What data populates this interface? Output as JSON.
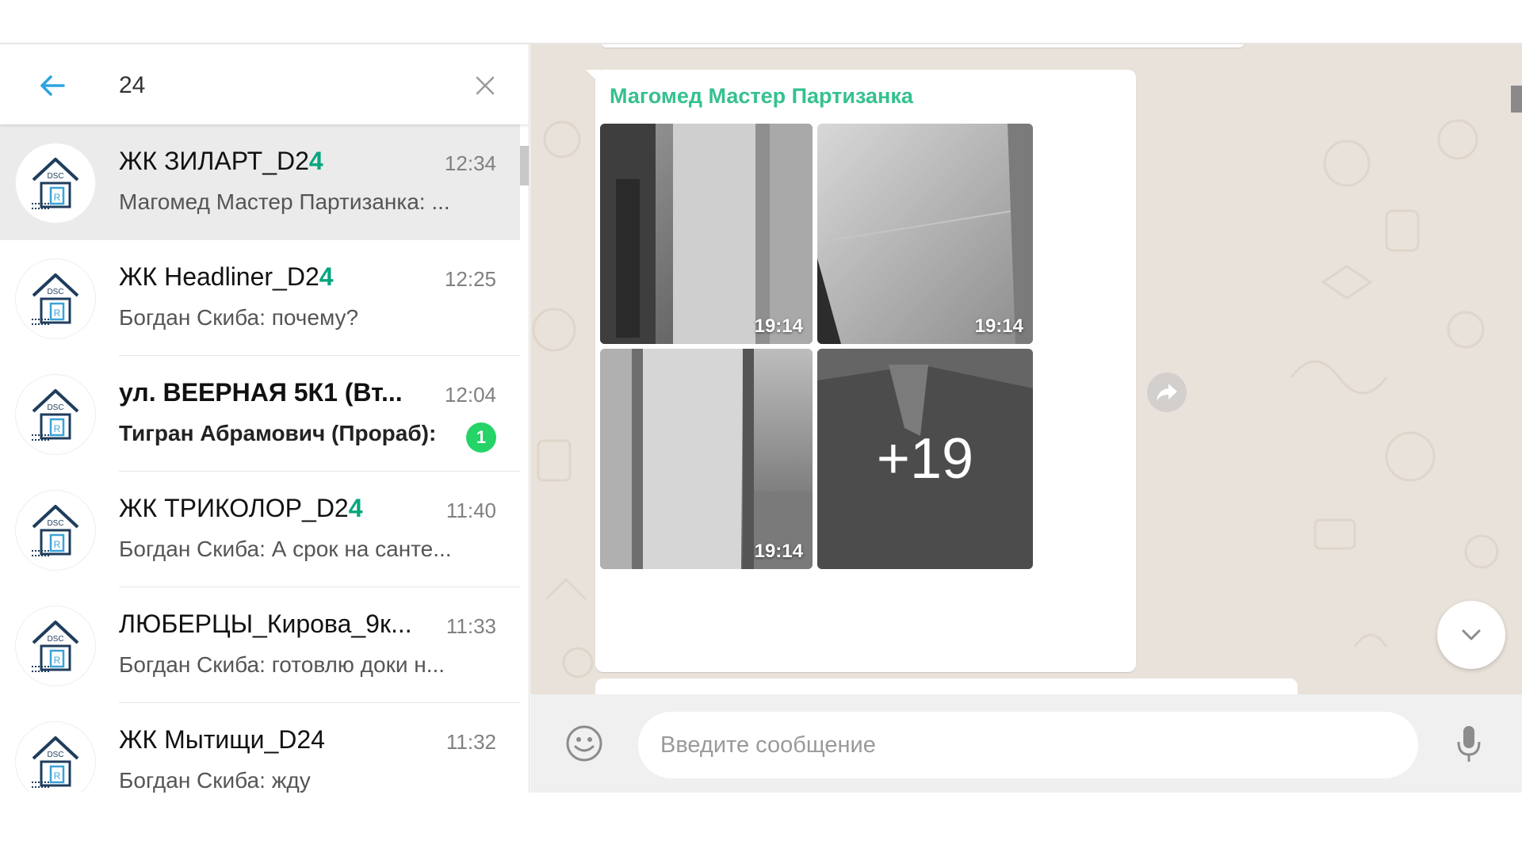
{
  "search": {
    "query": "24"
  },
  "chats": [
    {
      "name": "ЖК ЗИЛАРТ_D2",
      "name_highlight": "4",
      "time": "12:34",
      "preview": "Магомед Мастер Партизанка: ...",
      "active": true,
      "unread": null
    },
    {
      "name": "ЖК Headliner_D2",
      "name_highlight": "4",
      "time": "12:25",
      "preview": "Богдан Скиба: почему?",
      "active": false,
      "unread": null
    },
    {
      "name": "ул. ВЕЕРНАЯ 5К1 (Вт...",
      "name_highlight": "",
      "time": "12:04",
      "preview": "Тигран Абрамович (Прораб):",
      "active": false,
      "unread": "1"
    },
    {
      "name": "ЖК ТРИКОЛОР_D2",
      "name_highlight": "4",
      "time": "11:40",
      "preview": "Богдан Скиба: А срок на санте...",
      "active": false,
      "unread": null
    },
    {
      "name": "ЛЮБЕРЦЫ_Кирова_9к...",
      "name_highlight": "",
      "time": "11:33",
      "preview": "Богдан Скиба: готовлю доки н...",
      "active": false,
      "unread": null
    },
    {
      "name": "ЖК Мытищи_D24",
      "name_highlight": "",
      "time": "11:32",
      "preview": "Богдан Скиба: жду",
      "active": false,
      "unread": null
    }
  ],
  "conversation": {
    "message": {
      "sender": "Магомед Мастер Партизанка",
      "media": [
        {
          "time": "19:14",
          "icon": "photo-thumbnail"
        },
        {
          "time": "19:14",
          "icon": "photo-thumbnail"
        },
        {
          "time": "19:14",
          "icon": "photo-thumbnail"
        },
        {
          "time": "",
          "more_count": "+19",
          "icon": "photo-thumbnail"
        }
      ]
    },
    "composer": {
      "placeholder": "Введите сообщение"
    }
  },
  "colors": {
    "highlight": "#07a67e",
    "sender": "#35c18e",
    "unread_badge": "#25d366",
    "back_arrow": "#2da4e0",
    "chat_background": "#e9e2da"
  },
  "icons": {
    "back": "back-arrow-icon",
    "clear": "close-icon",
    "emoji": "emoji-icon",
    "mic": "microphone-icon",
    "forward": "forward-icon",
    "scroll_down": "chevron-down-icon",
    "avatar": "building-logo-icon"
  }
}
